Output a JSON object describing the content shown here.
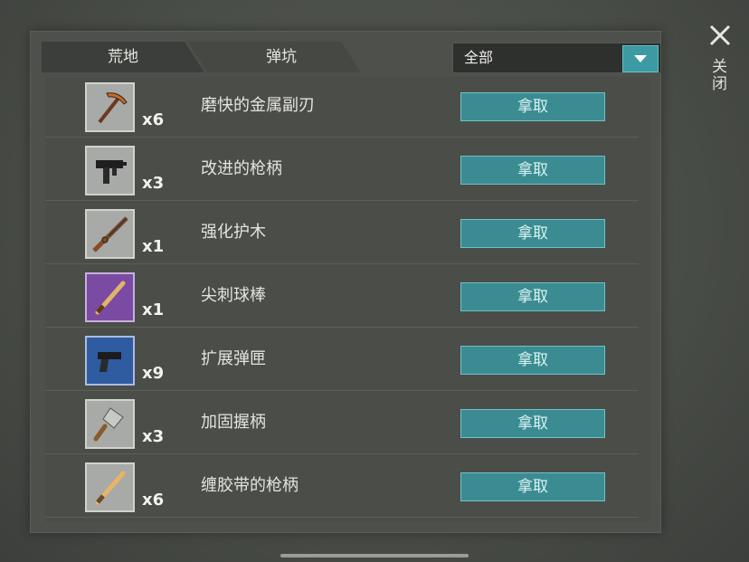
{
  "tabs": [
    {
      "label": "荒地"
    },
    {
      "label": "弹坑"
    }
  ],
  "filter": {
    "value": "全部"
  },
  "close": {
    "label": "关闭"
  },
  "items": [
    {
      "name": "磨快的金属副刃",
      "qty": "x6",
      "bg": "gray",
      "icon": "pickaxe-icon",
      "action": "拿取"
    },
    {
      "name": "改进的枪柄",
      "qty": "x3",
      "bg": "gray",
      "icon": "submachine-gun-icon",
      "action": "拿取"
    },
    {
      "name": "强化护木",
      "qty": "x1",
      "bg": "gray",
      "icon": "rifle-icon",
      "action": "拿取"
    },
    {
      "name": "尖刺球棒",
      "qty": "x1",
      "bg": "purple",
      "icon": "baseball-bat-icon",
      "action": "拿取"
    },
    {
      "name": "扩展弹匣",
      "qty": "x9",
      "bg": "blue",
      "icon": "pistol-icon",
      "action": "拿取"
    },
    {
      "name": "加固握柄",
      "qty": "x3",
      "bg": "gray",
      "icon": "cleaver-icon",
      "action": "拿取"
    },
    {
      "name": "缠胶带的枪柄",
      "qty": "x6",
      "bg": "gray",
      "icon": "taped-bat-icon",
      "action": "拿取"
    }
  ],
  "colors": {
    "accent": "#3b8c92",
    "panel": "#4d504b",
    "rare_purple": "#7b4aa2",
    "rare_blue": "#2f5ba0"
  }
}
